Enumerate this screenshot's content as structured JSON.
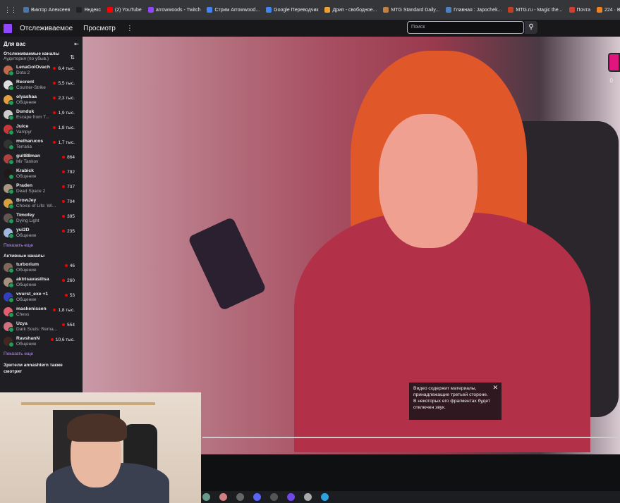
{
  "bookmarks": [
    {
      "label": "Виктор Алексеев",
      "color": "#4a76a8"
    },
    {
      "label": "Яндекс",
      "color": "#222"
    },
    {
      "label": "(2) YouTube",
      "color": "#ff0000"
    },
    {
      "label": "arrowwoods - Twitch",
      "color": "#9147ff"
    },
    {
      "label": "Стрим Arrowwood...",
      "color": "#4285f4"
    },
    {
      "label": "Google Переводчик",
      "color": "#4285f4"
    },
    {
      "label": "Дрип - свободное...",
      "color": "#f0a030"
    },
    {
      "label": "MTG Standard Daily...",
      "color": "#c08040"
    },
    {
      "label": "Главная : Japochek...",
      "color": "#5080c0"
    },
    {
      "label": "MTG.ru - Magic the...",
      "color": "#c04020"
    },
    {
      "label": "Почта",
      "color": "#d04030"
    },
    {
      "label": "224 · Входящие —...",
      "color": "#f08020"
    }
  ],
  "nav": {
    "following": "Отслеживаемое",
    "browse": "Просмотр",
    "more": "⋮",
    "search_placeholder": "Поиск",
    "search_icon": "⚲"
  },
  "sidebar": {
    "title": "Для вас",
    "collapse_icon": "⇤",
    "followed_title": "Отслеживаемые каналы",
    "followed_sort": "Аудитория (по убыв.)",
    "sort_icon": "⇅",
    "followed": [
      {
        "name": "LenaGolOvach",
        "game": "Dota 2",
        "viewers": "6,4 тыс.",
        "color": "#c06848"
      },
      {
        "name": "Recrent",
        "game": "Counter-Strike",
        "viewers": "5,5 тыс.",
        "color": "#ddd"
      },
      {
        "name": "olyashaa",
        "game": "Общение",
        "viewers": "2,3 тыс.",
        "color": "#e0a040"
      },
      {
        "name": "Dunduk",
        "game": "Escape from T...",
        "viewers": "1,9 тыс.",
        "color": "#ccc"
      },
      {
        "name": "Juice",
        "game": "Vampyr",
        "viewers": "1,8 тыс.",
        "color": "#c83838"
      },
      {
        "name": "melharucos",
        "game": "Terraria",
        "viewers": "1,7 тыс.",
        "color": "#333"
      },
      {
        "name": "guit88man",
        "game": "Mir Tankov",
        "viewers": "864",
        "color": "#b04040"
      },
      {
        "name": "Krabick",
        "game": "Общение",
        "viewers": "792",
        "color": "#201818"
      },
      {
        "name": "Praden",
        "game": "Dead Space 2",
        "viewers": "737",
        "color": "#a89880"
      },
      {
        "name": "BrowJey",
        "game": "Choice of Life: Wi...",
        "viewers": "704",
        "color": "#d8a040"
      },
      {
        "name": "Timofey",
        "game": "Dying Light",
        "viewers": "395",
        "color": "#605850"
      },
      {
        "name": "yui2D",
        "game": "Общение",
        "viewers": "235",
        "color": "#a0b8e0"
      }
    ],
    "show_more": "Показать еще",
    "active_title": "Активные каналы",
    "active": [
      {
        "name": "turborium",
        "game": "Общение",
        "viewers": "46",
        "color": "#806858"
      },
      {
        "name": "aktrisavasilisa",
        "game": "Общение",
        "viewers": "260",
        "color": "#a89080"
      },
      {
        "name": "vvurst_exe +1",
        "game": "Общение",
        "viewers": "53",
        "color": "#3040c0"
      },
      {
        "name": "maskenissen",
        "game": "Chess",
        "viewers": "1,8 тыс.",
        "color": "#e06070"
      },
      {
        "name": "Uzya",
        "game": "Dark Souls: Rema...",
        "viewers": "554",
        "color": "#d07080"
      },
      {
        "name": "RavshanN",
        "game": "Общение",
        "viewers": "10,6 тыс.",
        "color": "#402820"
      }
    ],
    "show_more_2": "Показать еще",
    "also_watch": "Зрители annashtern также смотрят"
  },
  "player": {
    "notice": "Видео содержит материалы, принадлежащие третьей стороне. В некоторых его фрагментах будет отключен звук.",
    "notice_close": "✕",
    "side_count": "0"
  },
  "taskbar": [
    {
      "name": "app-1",
      "color": "#6a9a8a"
    },
    {
      "name": "app-2",
      "color": "#d08080"
    },
    {
      "name": "app-3",
      "color": "#666"
    },
    {
      "name": "discord",
      "color": "#5865f2"
    },
    {
      "name": "obs",
      "color": "#555"
    },
    {
      "name": "app-6",
      "color": "#7048e8"
    },
    {
      "name": "app-7",
      "color": "#aaa"
    },
    {
      "name": "telegram",
      "color": "#2aa3e0"
    }
  ]
}
